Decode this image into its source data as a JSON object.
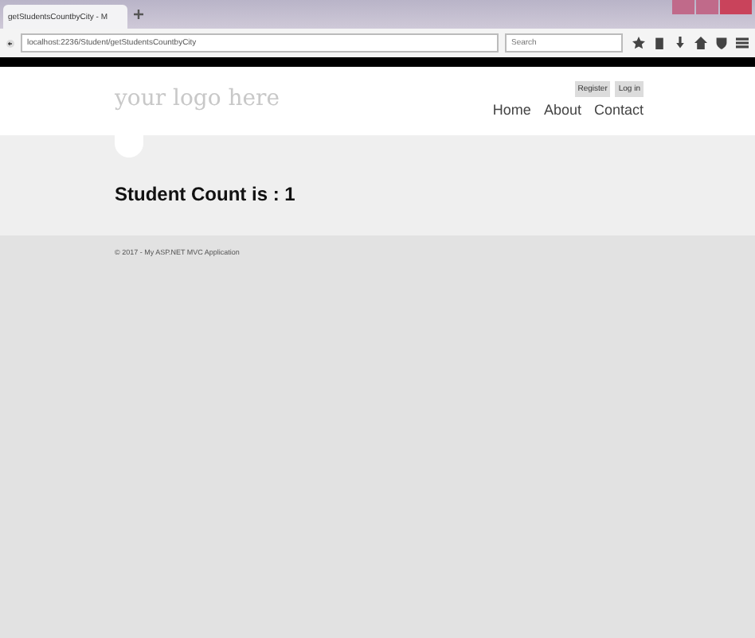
{
  "browser": {
    "tab_title": "getStudentsCountbyCity - M",
    "url": "localhost:2236/Student/getStudentsCountbyCity",
    "search": {
      "placeholder": "Search"
    }
  },
  "header": {
    "logo": "your logo here",
    "account_links": [
      "Register",
      "Log in"
    ],
    "nav": [
      "Home",
      "About",
      "Contact"
    ]
  },
  "content": {
    "heading": "Student Count is : 1"
  },
  "footer": {
    "text": "© 2017 - My ASP.NET MVC Application"
  }
}
